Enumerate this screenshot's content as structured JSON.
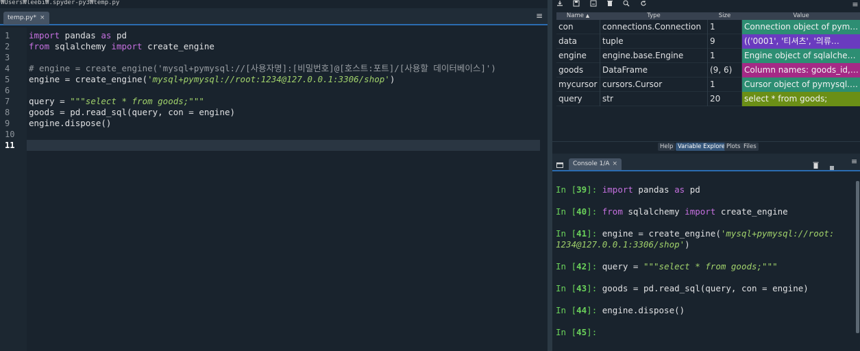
{
  "editor": {
    "path": "/Users/leebi/.spyder-py3/temp.py",
    "path_display": "₩Users₩leebi₩.spyder-py3₩temp.py",
    "tab_label": "temp.py*",
    "tab_close": "×",
    "menu_icon": "≡",
    "line_numbers": [
      "1",
      "2",
      "3",
      "4",
      "5",
      "6",
      "7",
      "8",
      "9",
      "10",
      "11"
    ],
    "current_line": "11",
    "lines": [
      [
        {
          "t": "import",
          "c": "kw"
        },
        {
          "t": " pandas ",
          "c": ""
        },
        {
          "t": "as",
          "c": "kw"
        },
        {
          "t": " pd",
          "c": ""
        }
      ],
      [
        {
          "t": "from",
          "c": "kw"
        },
        {
          "t": " sqlalchemy ",
          "c": ""
        },
        {
          "t": "import",
          "c": "kw"
        },
        {
          "t": " create_engine",
          "c": ""
        }
      ],
      [],
      [
        {
          "t": "# engine = create_engine('mysql+pymysql://[사용자명]:[비밀번호]@[호스트:포트]/[사용할 데이터베이스]')",
          "c": "cmt"
        }
      ],
      [
        {
          "t": "engine = create_engine(",
          "c": ""
        },
        {
          "t": "'mysql+pymysql://root:1234@127.0.0.1:3306/shop'",
          "c": "str"
        },
        {
          "t": ")",
          "c": ""
        }
      ],
      [],
      [
        {
          "t": "query = ",
          "c": ""
        },
        {
          "t": "\"\"\"select * from goods;\"\"\"",
          "c": "str"
        }
      ],
      [
        {
          "t": "goods = pd.read_sql(query, con = engine)",
          "c": ""
        }
      ],
      [
        {
          "t": "engine.dispose()",
          "c": ""
        }
      ],
      [],
      []
    ]
  },
  "variable_explorer": {
    "columns": [
      "Name",
      "Type",
      "Size",
      "Value"
    ],
    "sort_indicator": "▲",
    "rows": [
      {
        "name": "con",
        "type": "connections.Connection",
        "size": "1",
        "value": "Connection object of pymy…",
        "color": "#2d8e73"
      },
      {
        "name": "data",
        "type": "tuple",
        "size": "9",
        "value": "(('0001', '티셔츠', '의류…",
        "color": "#6a3bbf"
      },
      {
        "name": "engine",
        "type": "engine.base.Engine",
        "size": "1",
        "value": "Engine object of sqlalche…",
        "color": "#2d8e73"
      },
      {
        "name": "goods",
        "type": "DataFrame",
        "size": "(9, 6)",
        "value": "Column names: goods_id, g…",
        "color": "#a52a86"
      },
      {
        "name": "mycursor",
        "type": "cursors.Cursor",
        "size": "1",
        "value": "Cursor object of pymysql.…",
        "color": "#2d8e73"
      },
      {
        "name": "query",
        "type": "str",
        "size": "20",
        "value": "select * from goods;",
        "color": "#6b8f16"
      }
    ],
    "pane_tabs": [
      {
        "label": "Help",
        "active": false
      },
      {
        "label": "Variable Explorer",
        "active": true
      },
      {
        "label": "Plots",
        "active": false
      },
      {
        "label": "Files",
        "active": false
      }
    ]
  },
  "console": {
    "tab_label": "Console 1/A",
    "tab_close": "×",
    "menu_icon": "≡",
    "entries": [
      {
        "num": "39",
        "parts": [
          {
            "t": "import",
            "c": "kw"
          },
          {
            "t": " pandas ",
            "c": ""
          },
          {
            "t": "as",
            "c": "kw"
          },
          {
            "t": " pd",
            "c": ""
          }
        ]
      },
      {
        "num": "40",
        "parts": [
          {
            "t": "from",
            "c": "kw"
          },
          {
            "t": " sqlalchemy ",
            "c": ""
          },
          {
            "t": "import",
            "c": "kw"
          },
          {
            "t": " create_engine",
            "c": ""
          }
        ]
      },
      {
        "num": "41",
        "parts": [
          {
            "t": "engine = create_engine(",
            "c": ""
          },
          {
            "t": "'mysql+pymysql://root:",
            "c": "str"
          }
        ],
        "cont": [
          {
            "t": "1234@127.0.0.1:3306/shop'",
            "c": "str"
          },
          {
            "t": ")",
            "c": ""
          }
        ]
      },
      {
        "num": "42",
        "parts": [
          {
            "t": "query = ",
            "c": ""
          },
          {
            "t": "\"\"\"select * from goods;\"\"\"",
            "c": "str"
          }
        ]
      },
      {
        "num": "43",
        "parts": [
          {
            "t": "goods = pd.read_sql(query, con = engine)",
            "c": ""
          }
        ]
      },
      {
        "num": "44",
        "parts": [
          {
            "t": "engine.dispose()",
            "c": ""
          }
        ]
      },
      {
        "num": "45",
        "parts": []
      }
    ]
  },
  "colors": {
    "background": "#19232d",
    "accent": "#2b6cb1",
    "keyword": "#c670e0",
    "string": "#a1d26b",
    "prompt": "#6ad15a"
  },
  "icons": [
    "import-data-icon",
    "save-data-icon",
    "save-as-icon",
    "delete-all-icon",
    "search-icon",
    "refresh-icon",
    "options-menu-icon",
    "browse-tabs-icon",
    "remove-icon",
    "stop-icon",
    "console-options-icon"
  ]
}
